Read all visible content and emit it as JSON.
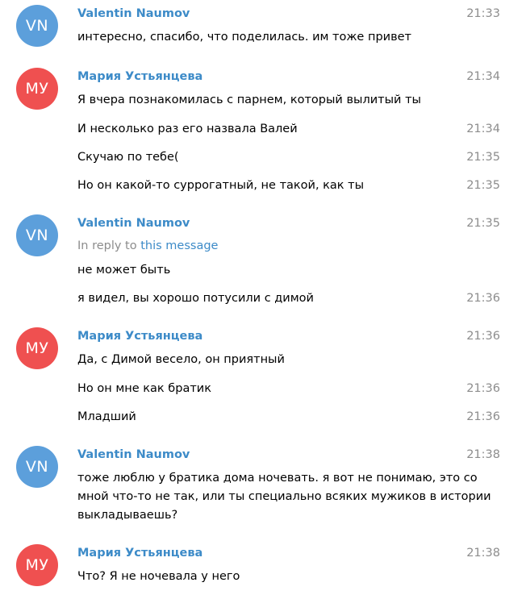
{
  "messages": {
    "g1": {
      "initials": "VN",
      "sender": "Valentin Naumov",
      "m1": {
        "text": "интересно, спасибо, что поделилась. им тоже привет",
        "time": "21:33"
      }
    },
    "g2": {
      "initials": "МУ",
      "sender": "Мария Устьянцева",
      "m1": {
        "text": "Я вчера познакомилась с парнем, который вылитый ты",
        "time": "21:34"
      },
      "m2": {
        "text": "И несколько раз его назвала Валей",
        "time": "21:34"
      },
      "m3": {
        "text": "Скучаю по тебе(",
        "time": "21:35"
      },
      "m4": {
        "text": "Но он какой-то суррогатный, не такой, как ты",
        "time": "21:35"
      }
    },
    "g3": {
      "initials": "VN",
      "sender": "Valentin Naumov",
      "reply_prefix": "In reply to",
      "reply_link": "this message",
      "m1": {
        "text": "не может быть",
        "time": "21:35"
      },
      "m2": {
        "text": "я видел, вы хорошо потусили с димой",
        "time": "21:36"
      }
    },
    "g4": {
      "initials": "МУ",
      "sender": "Мария Устьянцева",
      "m1": {
        "text": "Да, с Димой весело, он приятный",
        "time": "21:36"
      },
      "m2": {
        "text": "Но он мне как братик",
        "time": "21:36"
      },
      "m3": {
        "text": "Младший",
        "time": "21:36"
      }
    },
    "g5": {
      "initials": "VN",
      "sender": "Valentin Naumov",
      "m1": {
        "text": "тоже люблю у братика дома ночевать. я вот не понимаю, это со мной что-то не так, или ты специально всяких мужиков в истории выкладываешь?",
        "time": "21:38"
      }
    },
    "g6": {
      "initials": "МУ",
      "sender": "Мария Устьянцева",
      "m1": {
        "text": "Что? Я не ночевала у него",
        "time": "21:38"
      }
    }
  }
}
